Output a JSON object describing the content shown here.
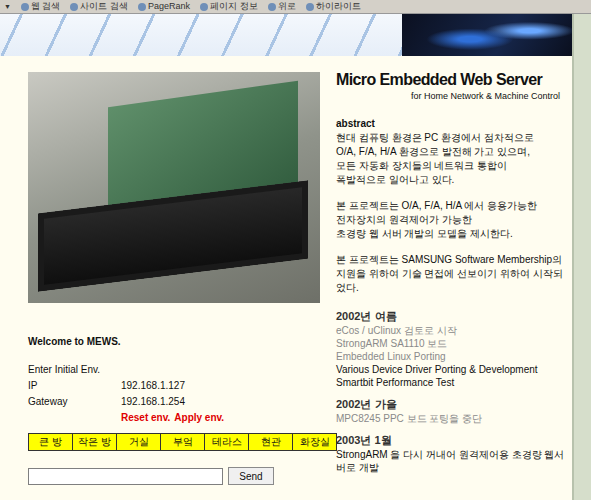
{
  "toolbar": {
    "dropdown": "▼",
    "items": [
      "웹 검색",
      "사이트 검색",
      "PageRank",
      "페이지 정보",
      "위로",
      "하이라이트"
    ]
  },
  "header": {
    "title": "Micro Embedded Web Server",
    "subtitle": "for Home Network & Machine Control"
  },
  "abstract": {
    "heading": "abstract",
    "paragraphs": [
      [
        "현대 컴퓨팅 환경은 PC 환경에서 점차적으로",
        "O/A, F/A, H/A 환경으로 발전해 가고 있으며,",
        "모든 자동화 장치들의 네트워크 통합이",
        "폭발적으로 일어나고 있다."
      ],
      [
        "본 프로젝트는 O/A, F/A, H/A 에서 응용가능한",
        "전자장치의 원격제어가 가능한",
        "초경량 웹 서버 개발의 모델을 제시한다."
      ],
      [
        "본 프로젝트는 SAMSUNG Software Membership의",
        "지원을 위하여 기술 면접에 선보이기 위하여 시작되었다."
      ]
    ]
  },
  "timeline": [
    {
      "heading": "2002년 여름",
      "lines": [
        {
          "text": "eCos / uClinux 검토로 시작",
          "faded": true
        },
        {
          "text": "StrongARM SA1110 보드",
          "faded": true
        },
        {
          "text": "Embedded Linux Porting",
          "faded": true
        },
        {
          "text": "Various Device Driver Porting & Development",
          "faded": false
        },
        {
          "text": "Smartbit Performance Test",
          "faded": false
        }
      ]
    },
    {
      "heading": "2002년 가을",
      "lines": [
        {
          "text": "MPC8245 PPC 보드 포팅을 중단",
          "faded": true
        }
      ]
    },
    {
      "heading": "2003년 1월",
      "lines": [
        {
          "text": "StrongARM 을 다시 꺼내어 원격제어용 초경량 웹서버로 개발",
          "faded": false
        }
      ]
    }
  ],
  "welcome": "Welcome to MEWS.",
  "env": {
    "heading": "Enter Initial Env.",
    "fields": [
      {
        "label": "IP",
        "value": "192.168.1.127"
      },
      {
        "label": "Gateway",
        "value": "192.168.1.254"
      }
    ],
    "actions": [
      "Reset env.",
      "Apply env."
    ]
  },
  "rooms": [
    "큰 방",
    "작은 방",
    "거실",
    "부엌",
    "테라스",
    "현관",
    "화장실"
  ],
  "message": {
    "value": "",
    "send": "Send"
  }
}
